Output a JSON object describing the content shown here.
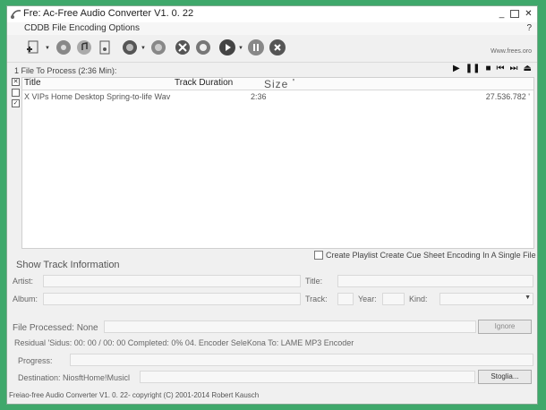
{
  "window": {
    "title": "Fre: Ac-Free Audio Converter V1. 0. 22"
  },
  "menu": {
    "items": "CDDB File Encoding Options",
    "help": "?"
  },
  "toolbar": {
    "site": "Www.frees.oro",
    "icons": [
      "add-file-icon",
      "add-folder-icon",
      "remove-icon",
      "clear-list-icon",
      "cddb-query-icon",
      "cddb-submit-icon",
      "settings-icon",
      "encoder-settings-icon",
      "play-encode-icon",
      "pause-icon",
      "stop-icon"
    ]
  },
  "status": {
    "files_to_process": "1 File To Process (2:36 Min):"
  },
  "player": {
    "play": "▶",
    "pause": "❚❚",
    "stop": "■",
    "prev": "⏮",
    "next": "⏭",
    "eject": "⏏"
  },
  "tracklist": {
    "columns": {
      "title": "Title",
      "duration": "Track Duration",
      "size": "Size"
    },
    "size_suffix": "'",
    "rows": [
      {
        "checked": true,
        "title": "X VIPs Home Desktop Spring-to-life Wav",
        "duration": "2:36",
        "size": "27.536.782 '"
      }
    ]
  },
  "cue": {
    "label": "Create Playlist Create Cue Sheet Encoding In A Single File",
    "checked": false
  },
  "track_info": {
    "section": "Show Track Information",
    "artist": "Artist:",
    "title": "Title:",
    "album": "Album:",
    "track": "Track:",
    "year": "Year:",
    "kind": "Kind:"
  },
  "progress": {
    "file_processed": "File Processed: None",
    "ignore": "Ignore",
    "residual": "Residual 'Sidus: 00: 00 / 00: 00 Completed: 0% 04. Encoder SeleKona To: LAME MP3 Encoder",
    "progress_label": "Progress:",
    "destination_label": "Destination: NiosftHome!Musicl",
    "browse": "Stoglia..."
  },
  "footer": {
    "text": "Freiao-free Audio Converter V1. 0. 22- copyright (C) 2001-2014 Robert Kausch"
  }
}
